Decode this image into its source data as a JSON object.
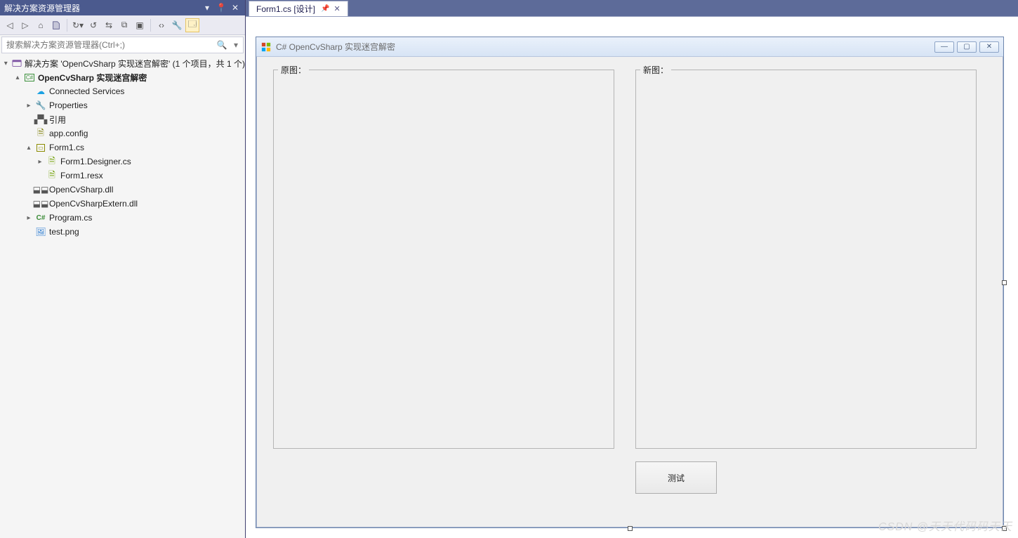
{
  "explorer": {
    "title": "解决方案资源管理器",
    "btn_dropdown": "▾",
    "btn_pin": "📌",
    "btn_close": "✕",
    "search_placeholder": "搜索解决方案资源管理器(Ctrl+;)",
    "toolbar_icons": {
      "back": "◀",
      "fwd": "▶",
      "home": "⌂",
      "scope": "⮌",
      "refresh": "⟳",
      "sync": "↺",
      "collapse": "⇄",
      "showall": "▭",
      "preview": "▣",
      "code": "‹›",
      "props": "🔧",
      "propsel": "▭"
    },
    "solution_line": "解决方案 'OpenCvSharp 实现迷宫解密' (1 个项目，共 1 个)",
    "project": "OpenCvSharp 实现迷宫解密",
    "items": {
      "connected": "Connected Services",
      "properties": "Properties",
      "references": "引用",
      "appconfig": "app.config",
      "form1": "Form1.cs",
      "form1designer": "Form1.Designer.cs",
      "form1resx": "Form1.resx",
      "dll1": "OpenCvSharp.dll",
      "dll2": "OpenCvSharpExtern.dll",
      "program": "Program.cs",
      "testpng": "test.png"
    }
  },
  "tab": {
    "label": "Form1.cs [设计]"
  },
  "form": {
    "title": "C# OpenCvSharp 实现迷宫解密",
    "group1": "原图：",
    "group2": "新图：",
    "btn_test": "测试"
  },
  "watermark": "CSDN @天天代码码天天"
}
